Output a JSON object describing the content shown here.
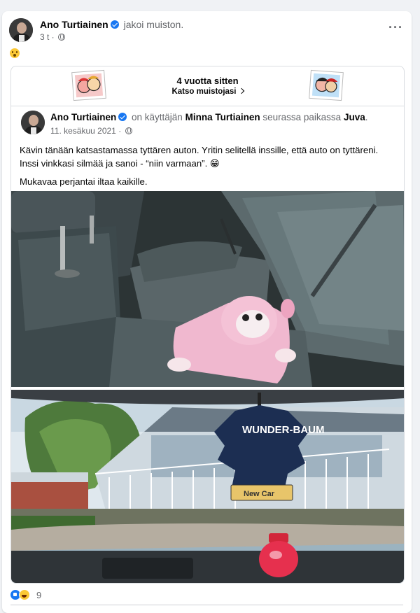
{
  "post": {
    "author": "Ano Turtiainen",
    "action": "jakoi muiston.",
    "time": "3 t",
    "privacy_icon": "globe-icon",
    "more_icon": "more-icon",
    "emoji": "astonished-face"
  },
  "memory": {
    "title": "4 vuotta sitten",
    "link": "Katso muistojasi"
  },
  "original_post": {
    "author": "Ano Turtiainen",
    "with_text": "on käyttäjän",
    "tagged": "Minna Turtiainen",
    "at_text": "seurassa paikassa",
    "place": "Juva",
    "date": "11. kesäkuu 2021",
    "paragraph1": "Kävin tänään katsastamassa tyttären auton. Yritin selitellä inssille, että auto on tyttäreni. Inssi vinkkasi silmää ja sanoi - “niin varmaan”. 😁",
    "paragraph2": "Mukavaa perjantai iltaa kaikille."
  },
  "photo2": {
    "freshener_brand": "WUNDER-BAUM",
    "freshener_label": "New Car"
  },
  "reactions": {
    "icons": [
      "like-icon",
      "haha-icon"
    ],
    "count": "9"
  },
  "colors": {
    "accent": "#1877f2",
    "muted_text": "#65676b",
    "background": "#f0f2f5"
  }
}
